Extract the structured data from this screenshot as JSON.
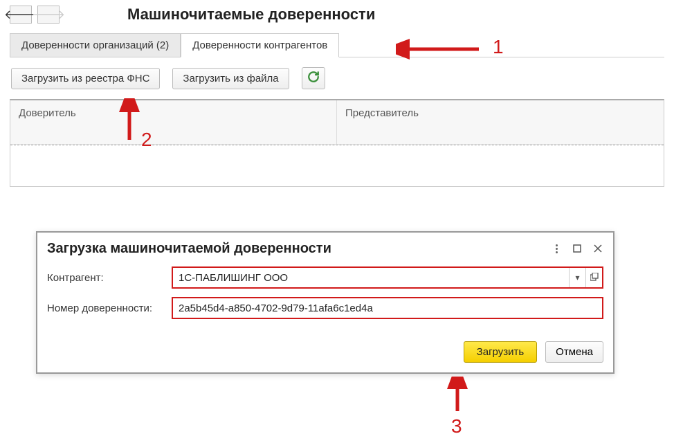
{
  "header": {
    "page_title": "Машиночитаемые доверенности"
  },
  "tabs": [
    {
      "label": "Доверенности организаций (2)",
      "active": false
    },
    {
      "label": "Доверенности контрагентов",
      "active": true
    }
  ],
  "toolbar": {
    "load_from_registry": "Загрузить из реестра ФНС",
    "load_from_file": "Загрузить из файла"
  },
  "table": {
    "col_grantor": "Доверитель",
    "col_representative": "Представитель"
  },
  "dialog": {
    "title": "Загрузка машиночитаемой доверенности",
    "counterparty_label": "Контрагент:",
    "counterparty_value": "1С-ПАБЛИШИНГ ООО",
    "poa_number_label": "Номер доверенности:",
    "poa_number_value": "2a5b45d4-a850-4702-9d79-11afa6c1ed4a",
    "load_btn": "Загрузить",
    "cancel_btn": "Отмена"
  },
  "annotations": {
    "n1": "1",
    "n2": "2",
    "n3": "3"
  }
}
